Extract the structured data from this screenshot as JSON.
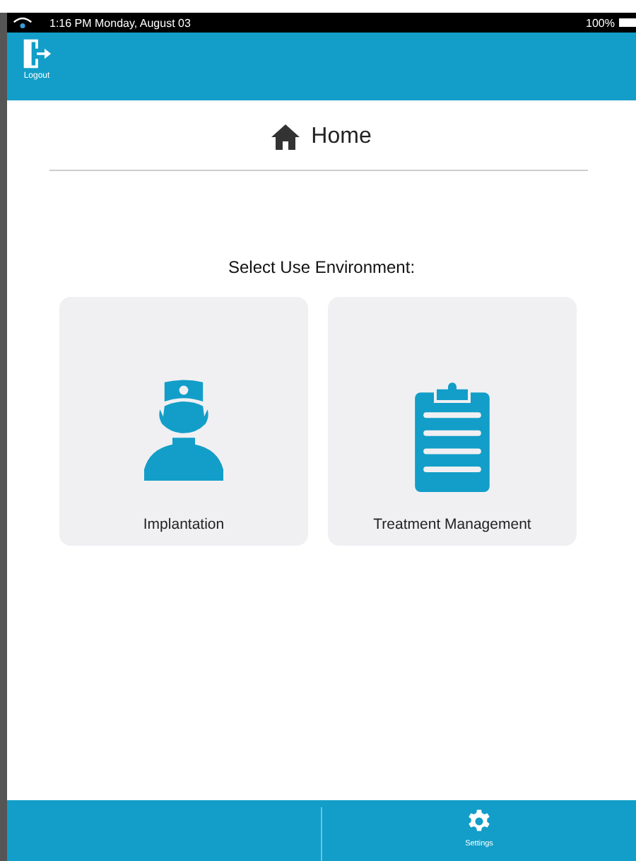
{
  "status_bar": {
    "time": "1:16 PM Monday, August 03",
    "battery": "100%"
  },
  "header": {
    "logout_label": "Logout"
  },
  "title": "Home",
  "prompt": "Select Use Environment:",
  "options": [
    {
      "label": "Implantation",
      "kind": "surgeon"
    },
    {
      "label": "Treatment Management",
      "kind": "clipboard"
    }
  ],
  "footer": {
    "settings_label": "Settings"
  }
}
